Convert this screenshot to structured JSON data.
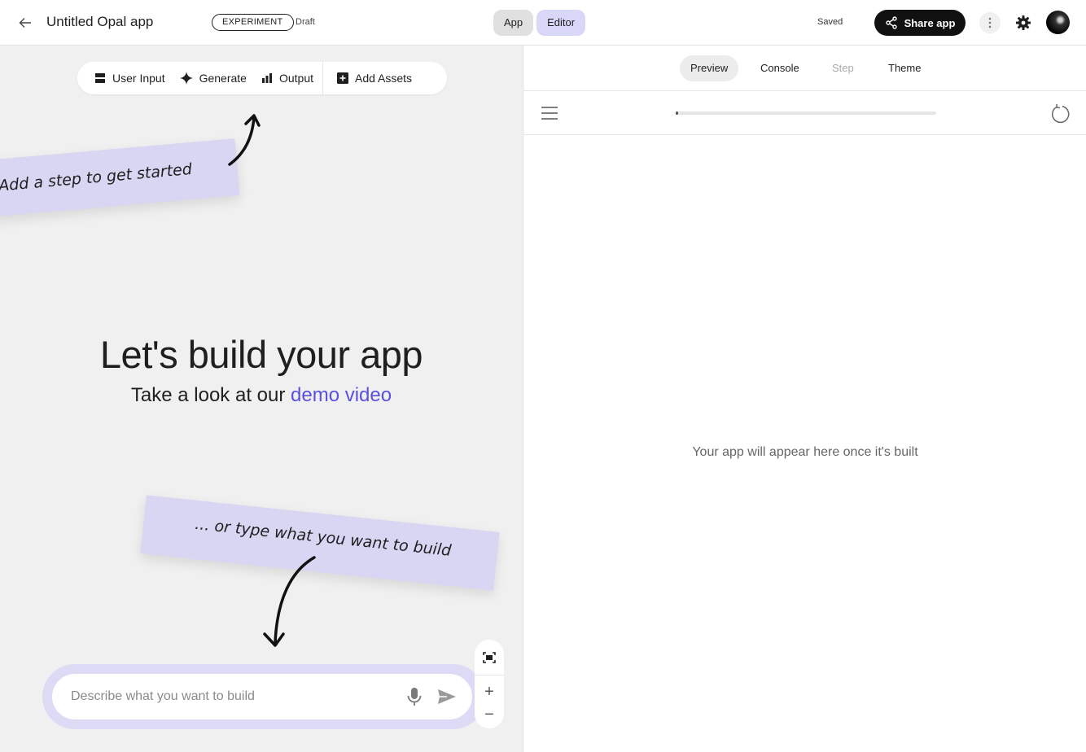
{
  "header": {
    "app_title": "Untitled Opal app",
    "badge": "EXPERIMENT",
    "status": "Draft",
    "mode_app": "App",
    "mode_editor": "Editor",
    "saved": "Saved",
    "share_label": "Share app"
  },
  "toolbar": {
    "user_input": "User Input",
    "generate": "Generate",
    "output": "Output",
    "add_assets": "Add Assets"
  },
  "notes": {
    "top": "Add a step to get started",
    "bottom": "... or type what you want to build"
  },
  "hero": {
    "title": "Let's build your app",
    "subtitle_prefix": "Take a look at our ",
    "subtitle_link": "demo video"
  },
  "prompt": {
    "placeholder": "Describe what you want to build"
  },
  "zoom": {
    "in": "+",
    "out": "−"
  },
  "preview": {
    "tabs": [
      "Preview",
      "Console",
      "Step",
      "Theme"
    ],
    "progress_percent": 1,
    "empty_message": "Your app will appear here once it's built"
  },
  "colors": {
    "accent": "#5b4fe0",
    "editor_active": "#d9d7f7",
    "note_bg": "#d8d6f3",
    "canvas_bg": "#f0f0f0"
  }
}
